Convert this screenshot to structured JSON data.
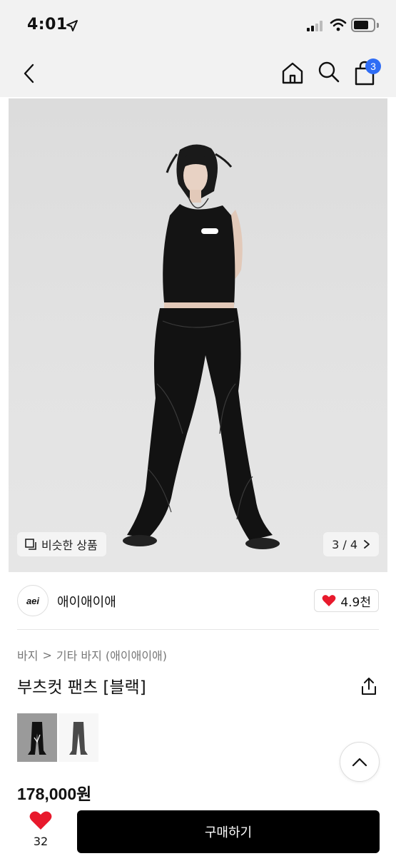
{
  "status_bar": {
    "time": "4:01"
  },
  "nav": {
    "cart_count": "3"
  },
  "gallery": {
    "similar_label": "비슷한 상품",
    "counter": "3 / 4"
  },
  "brand": {
    "logo_text": "aei",
    "name": "애이애이애",
    "likes": "4.9천"
  },
  "breadcrumb": {
    "category": "바지",
    "separator": ">",
    "subcategory": "기타 바지 (애이애이애)"
  },
  "product": {
    "title": "부츠컷 팬츠 [블랙]",
    "price": "178,000원"
  },
  "bottom_bar": {
    "wish_count": "32",
    "buy_label": "구매하기"
  },
  "colors": {
    "accent_badge": "#2f6df5",
    "heart": "#e8192c",
    "buy_button": "#000000"
  }
}
